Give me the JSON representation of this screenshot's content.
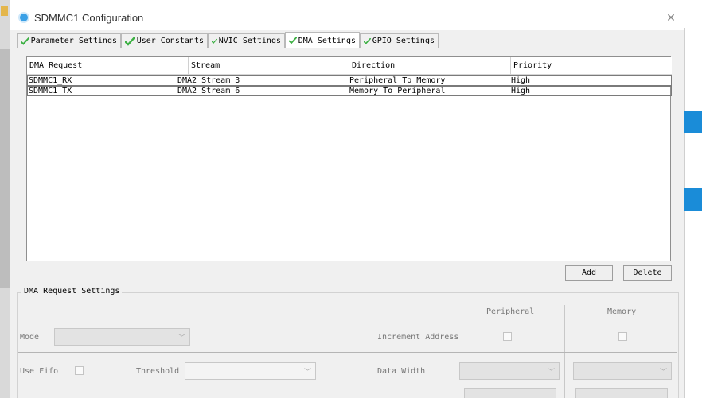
{
  "window": {
    "title": "SDMMC1 Configuration",
    "close_glyph": "✕"
  },
  "tabs": [
    {
      "label": "Parameter Settings",
      "icon": "check-icon",
      "active": false
    },
    {
      "label": "User Constants",
      "icon": "check-icon",
      "active": false
    },
    {
      "label": "NVIC Settings",
      "icon": "check-icon",
      "active": false
    },
    {
      "label": "DMA Settings",
      "icon": "check-icon",
      "active": true
    },
    {
      "label": "GPIO Settings",
      "icon": "check-icon",
      "active": false
    }
  ],
  "dma_table": {
    "headers": [
      "DMA Request",
      "Stream",
      "Direction",
      "Priority"
    ],
    "rows": [
      [
        "SDMMC1_RX",
        "DMA2 Stream 3",
        "Peripheral To Memory",
        "High"
      ],
      [
        "SDMMC1_TX",
        "DMA2 Stream 6",
        "Memory To Peripheral",
        "High"
      ]
    ]
  },
  "buttons": {
    "add": "Add",
    "delete": "Delete"
  },
  "request_settings": {
    "group_title": "DMA Request Settings",
    "peripheral_header": "Peripheral",
    "memory_header": "Memory",
    "mode_label": "Mode",
    "mode_value": "",
    "increment_address_label": "Increment Address",
    "use_fifo_label": "Use Fifo",
    "threshold_label": "Threshold",
    "threshold_value": "",
    "data_width_label": "Data Width",
    "peripheral_data_width": "",
    "memory_data_width": ""
  },
  "colors": {
    "check_green": "#3cb043",
    "accent_blue": "#1a8cd8"
  }
}
